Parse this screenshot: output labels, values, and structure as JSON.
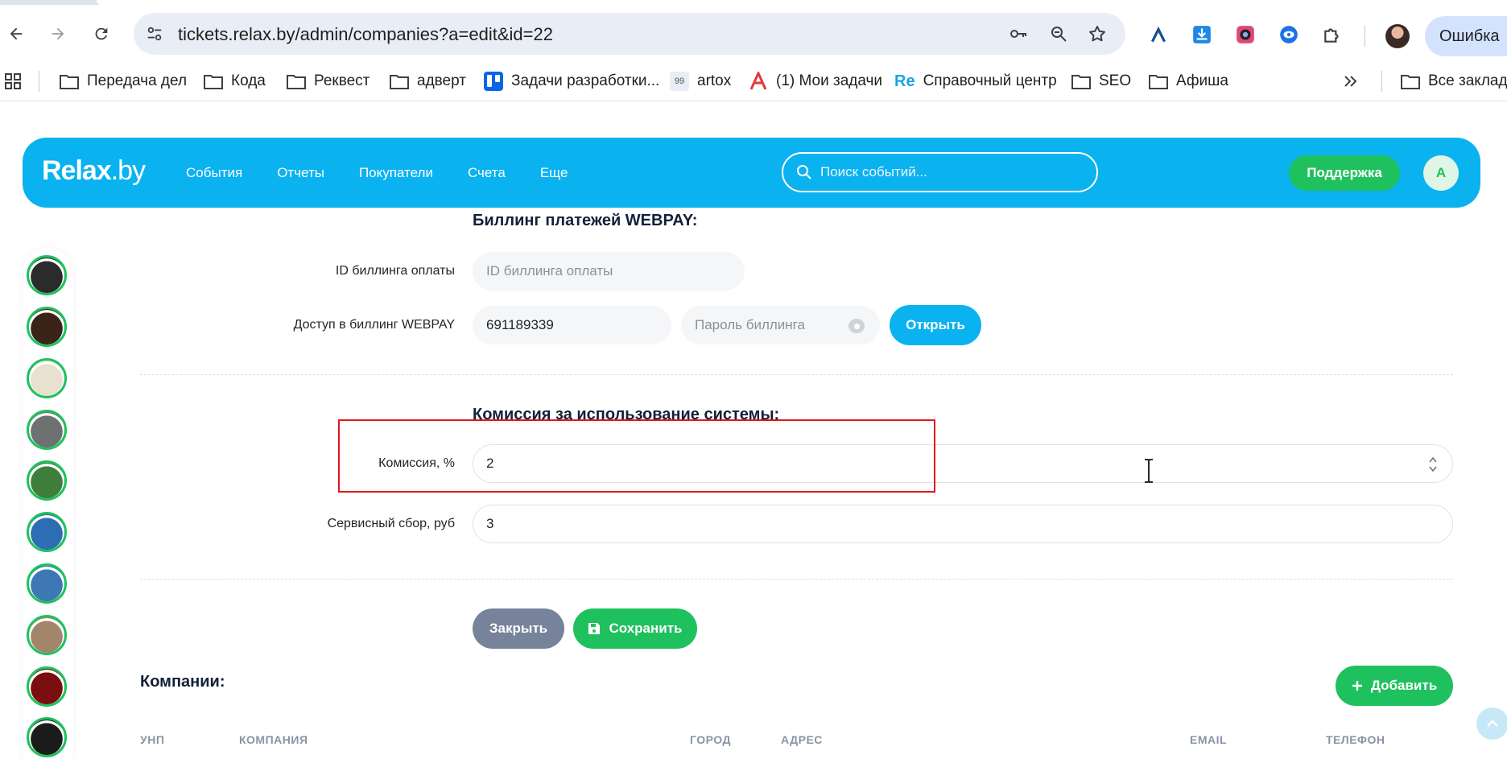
{
  "browser": {
    "url": "tickets.relax.by/admin/companies?a=edit&id=22",
    "error_label": "Ошибка",
    "bookmarks": [
      {
        "label": "Передача дел",
        "icon": "folder-icon"
      },
      {
        "label": "Кода",
        "icon": "folder-icon"
      },
      {
        "label": "Реквест",
        "icon": "folder-icon"
      },
      {
        "label": "адверт",
        "icon": "folder-icon"
      },
      {
        "label": "Задачи разработки...",
        "icon": "trello-icon"
      },
      {
        "label": "artox",
        "icon": "artox-icon"
      },
      {
        "label": "(1) Мои задачи",
        "icon": "a-logo-icon"
      },
      {
        "label": "Справочный центр",
        "icon": "re-logo-icon"
      },
      {
        "label": "SEO",
        "icon": "folder-icon"
      },
      {
        "label": "Афиша",
        "icon": "folder-icon"
      }
    ],
    "all_bookmarks": "Все закладк",
    "artox_badge": "99",
    "re_logo_text": "Re"
  },
  "header": {
    "logo_main": "Relax",
    "logo_suffix": ".by",
    "nav": [
      "События",
      "Отчеты",
      "Покупатели",
      "Счета",
      "Еще"
    ],
    "search_placeholder": "Поиск событий...",
    "support_label": "Поддержка",
    "avatar_letter": "A"
  },
  "billing": {
    "title": "Биллинг платежей WEBPAY:",
    "id_label": "ID биллинга оплаты",
    "id_placeholder": "ID биллинга оплаты",
    "access_label": "Доступ в биллинг WEBPAY",
    "access_login": "691189339",
    "password_placeholder": "Пароль биллинга",
    "open_button": "Открыть"
  },
  "commission": {
    "title": "Комиссия за использование системы:",
    "percent_label": "Комиссия, %",
    "percent_value": "2",
    "fee_label": "Сервисный сбор, руб",
    "fee_value": "3"
  },
  "actions": {
    "close_button": "Закрыть",
    "save_button": "Сохранить"
  },
  "companies": {
    "title": "Компании:",
    "add_button": "Добавить",
    "columns": [
      "УНП",
      "КОМПАНИЯ",
      "ГОРОД",
      "АДРЕС",
      "EMAIL",
      "ТЕЛЕФОН"
    ]
  },
  "rail": {
    "colors": [
      "#2b2b2b",
      "#3a2418",
      "#e9e1d0",
      "#6d7172",
      "#3f7d3a",
      "#2c6db3",
      "#3d78b5",
      "#a1866a",
      "#7a0d0d",
      "#1b1b1b"
    ]
  },
  "colors": {
    "brand": "#0ab2ef",
    "success": "#1fc15e",
    "highlight": "#e01818"
  }
}
